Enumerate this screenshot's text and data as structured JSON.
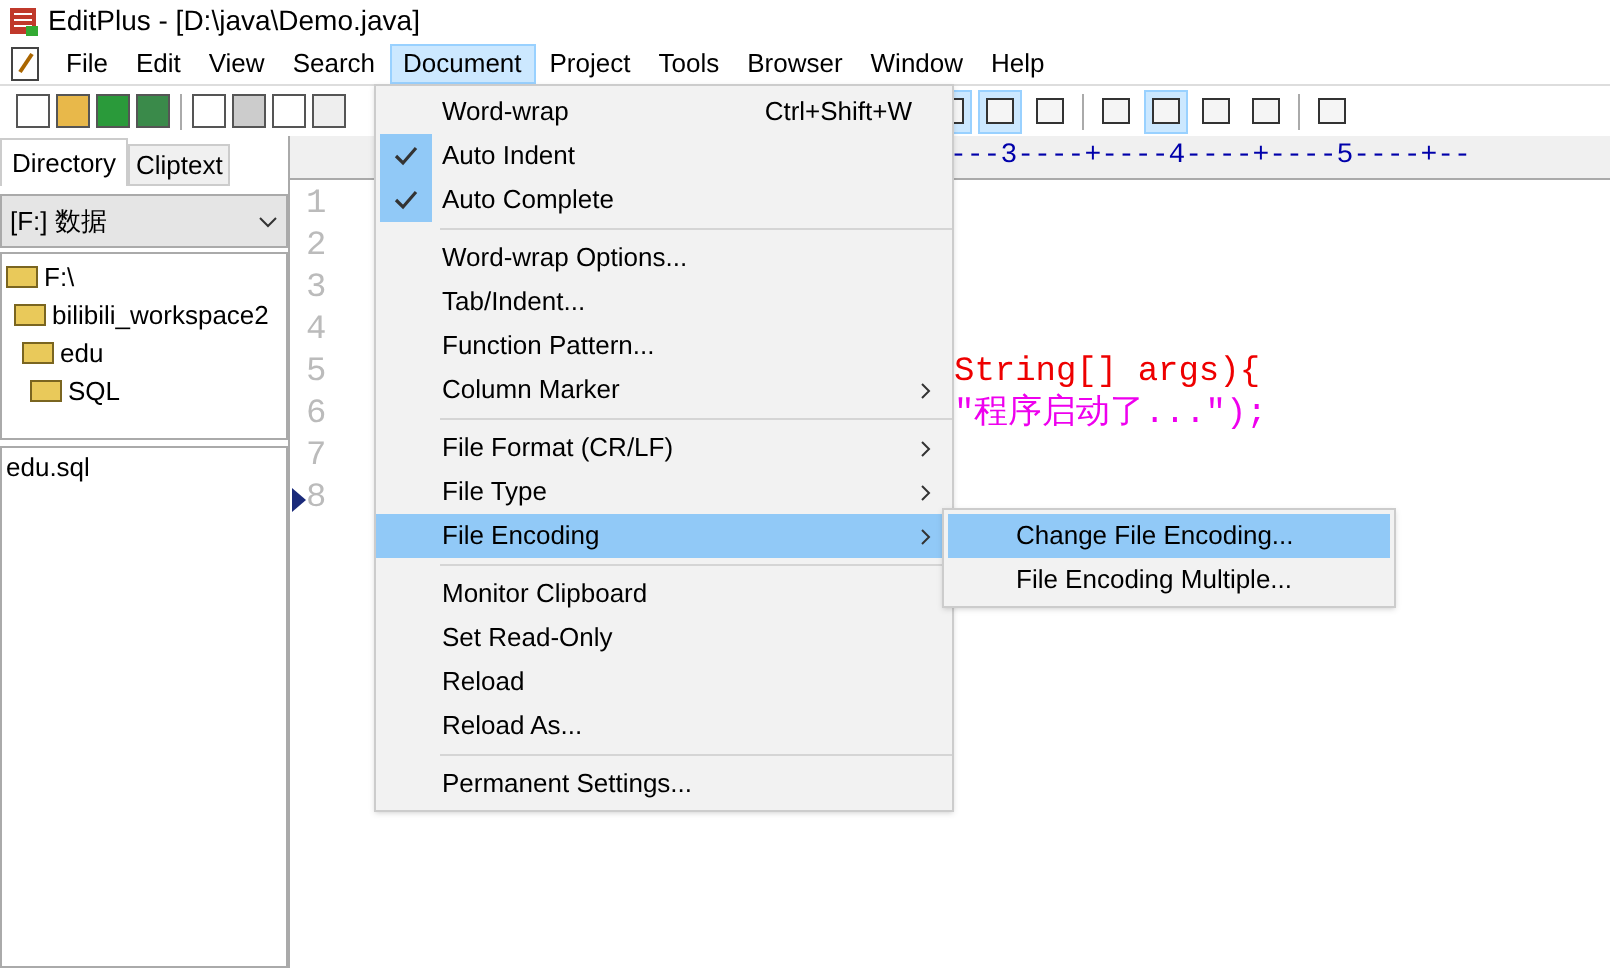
{
  "window": {
    "title": "EditPlus - [D:\\java\\Demo.java]"
  },
  "menu_bar": [
    {
      "label": "File",
      "selected": false
    },
    {
      "label": "Edit",
      "selected": false
    },
    {
      "label": "View",
      "selected": false
    },
    {
      "label": "Search",
      "selected": false
    },
    {
      "label": "Document",
      "selected": true
    },
    {
      "label": "Project",
      "selected": false
    },
    {
      "label": "Tools",
      "selected": false
    },
    {
      "label": "Browser",
      "selected": false
    },
    {
      "label": "Window",
      "selected": false
    },
    {
      "label": "Help",
      "selected": false
    }
  ],
  "sidebar": {
    "tabs": [
      {
        "label": "Directory",
        "selected": true
      },
      {
        "label": "Cliptext",
        "selected": false
      }
    ],
    "drive": "[F:] 数据",
    "tree": [
      {
        "label": "F:\\",
        "children": [
          {
            "label": "bilibili_workspace2",
            "children": [
              {
                "label": "edu",
                "children": [
                  {
                    "label": "SQL"
                  }
                ]
              }
            ]
          }
        ]
      }
    ],
    "files": [
      "edu.sql"
    ]
  },
  "editor": {
    "ruler": "---3----+----4----+----5----+--",
    "lines": [
      {
        "number": "1",
        "current": false
      },
      {
        "number": "2",
        "current": false
      },
      {
        "number": "3",
        "current": false
      },
      {
        "number": "4",
        "current": false
      },
      {
        "number": "5",
        "right": "String[] args){",
        "current": false
      },
      {
        "number": "6",
        "right": "\"程序启动了...\");",
        "current": false
      },
      {
        "number": "7",
        "current": false
      },
      {
        "number": "8",
        "current": true
      }
    ]
  },
  "document_menu": [
    {
      "kind": "item",
      "label": "Word-wrap",
      "shortcut": "Ctrl+Shift+W",
      "checked": false,
      "submenu": false,
      "selected": false
    },
    {
      "kind": "item",
      "label": "Auto Indent",
      "checked": true,
      "submenu": false,
      "selected": false
    },
    {
      "kind": "item",
      "label": "Auto Complete",
      "checked": true,
      "submenu": false,
      "selected": false
    },
    {
      "kind": "separator"
    },
    {
      "kind": "item",
      "label": "Word-wrap Options...",
      "checked": false,
      "submenu": false,
      "selected": false
    },
    {
      "kind": "item",
      "label": "Tab/Indent...",
      "checked": false,
      "submenu": false,
      "selected": false
    },
    {
      "kind": "item",
      "label": "Function Pattern...",
      "checked": false,
      "submenu": false,
      "selected": false
    },
    {
      "kind": "item",
      "label": "Column Marker",
      "checked": false,
      "submenu": true,
      "selected": false
    },
    {
      "kind": "separator"
    },
    {
      "kind": "item",
      "label": "File Format (CR/LF)",
      "checked": false,
      "submenu": true,
      "selected": false
    },
    {
      "kind": "item",
      "label": "File Type",
      "checked": false,
      "submenu": true,
      "selected": false
    },
    {
      "kind": "item",
      "label": "File Encoding",
      "checked": false,
      "submenu": true,
      "selected": true
    },
    {
      "kind": "separator"
    },
    {
      "kind": "item",
      "label": "Monitor Clipboard",
      "checked": false,
      "submenu": false,
      "selected": false
    },
    {
      "kind": "item",
      "label": "Set Read-Only",
      "checked": false,
      "submenu": false,
      "selected": false
    },
    {
      "kind": "item",
      "label": "Reload",
      "checked": false,
      "submenu": false,
      "selected": false
    },
    {
      "kind": "item",
      "label": "Reload As...",
      "checked": false,
      "submenu": false,
      "selected": false
    },
    {
      "kind": "separator"
    },
    {
      "kind": "item",
      "label": "Permanent Settings...",
      "checked": false,
      "submenu": false,
      "selected": false
    }
  ],
  "encoding_submenu": [
    {
      "label": "Change File Encoding...",
      "selected": true
    },
    {
      "label": "File Encoding Multiple...",
      "selected": false
    }
  ]
}
